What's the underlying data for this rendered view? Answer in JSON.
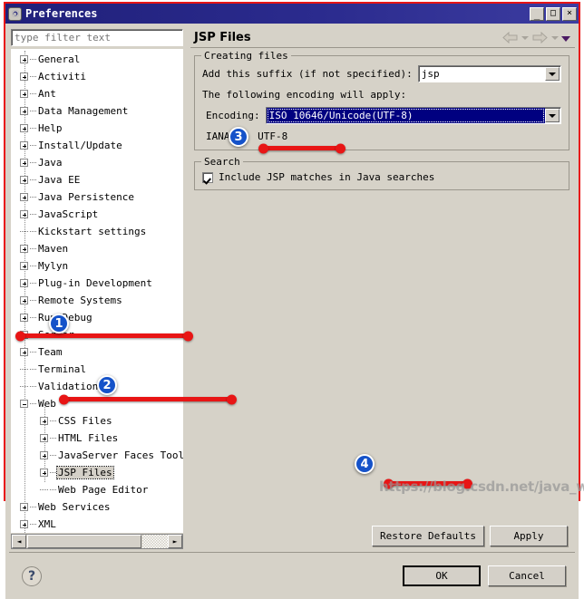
{
  "window": {
    "title": "Preferences",
    "icon": "gear-icon",
    "buttons": {
      "minimize": "_",
      "maximize": "□",
      "close": "×"
    }
  },
  "sidebar": {
    "filter": {
      "placeholder": "type filter text",
      "value": ""
    },
    "items": [
      {
        "label": "General",
        "depth": 0,
        "expander": "plus"
      },
      {
        "label": "Activiti",
        "depth": 0,
        "expander": "plus"
      },
      {
        "label": "Ant",
        "depth": 0,
        "expander": "plus"
      },
      {
        "label": "Data Management",
        "depth": 0,
        "expander": "plus"
      },
      {
        "label": "Help",
        "depth": 0,
        "expander": "plus"
      },
      {
        "label": "Install/Update",
        "depth": 0,
        "expander": "plus"
      },
      {
        "label": "Java",
        "depth": 0,
        "expander": "plus"
      },
      {
        "label": "Java EE",
        "depth": 0,
        "expander": "plus"
      },
      {
        "label": "Java Persistence",
        "depth": 0,
        "expander": "plus"
      },
      {
        "label": "JavaScript",
        "depth": 0,
        "expander": "plus"
      },
      {
        "label": "Kickstart settings",
        "depth": 0,
        "expander": "leaf"
      },
      {
        "label": "Maven",
        "depth": 0,
        "expander": "plus"
      },
      {
        "label": "Mylyn",
        "depth": 0,
        "expander": "plus"
      },
      {
        "label": "Plug-in Development",
        "depth": 0,
        "expander": "plus"
      },
      {
        "label": "Remote Systems",
        "depth": 0,
        "expander": "plus"
      },
      {
        "label": "Run/Debug",
        "depth": 0,
        "expander": "plus"
      },
      {
        "label": "Server",
        "depth": 0,
        "expander": "plus"
      },
      {
        "label": "Team",
        "depth": 0,
        "expander": "plus"
      },
      {
        "label": "Terminal",
        "depth": 0,
        "expander": "leaf"
      },
      {
        "label": "Validation",
        "depth": 0,
        "expander": "leaf"
      },
      {
        "label": "Web",
        "depth": 0,
        "expander": "minus"
      },
      {
        "label": "CSS Files",
        "depth": 1,
        "expander": "plus"
      },
      {
        "label": "HTML Files",
        "depth": 1,
        "expander": "plus"
      },
      {
        "label": "JavaServer Faces Tool",
        "depth": 1,
        "expander": "plus"
      },
      {
        "label": "JSP Files",
        "depth": 1,
        "expander": "plus",
        "selected": true
      },
      {
        "label": "Web Page Editor",
        "depth": 1,
        "expander": "leaf"
      },
      {
        "label": "Web Services",
        "depth": 0,
        "expander": "plus"
      },
      {
        "label": "XML",
        "depth": 0,
        "expander": "plus"
      }
    ],
    "hscroll": {
      "left_arrow": "◄",
      "right_arrow": "►"
    }
  },
  "page": {
    "title": "JSP Files",
    "nav": {
      "back": "back-arrow",
      "back_menu": "chevron-down-icon",
      "forward": "forward-arrow",
      "forward_menu": "chevron-down-icon",
      "view_menu": "view-menu-icon"
    },
    "creating_files": {
      "title": "Creating files",
      "suffix_label": "Add this suffix (if not specified):",
      "suffix_value": "jsp",
      "encoding_note": "The following encoding will apply:",
      "encoding_label": "Encoding:",
      "encoding_value": "ISO 10646/Unicode(UTF-8)",
      "iana_label": "IANA:",
      "iana_value": "UTF-8"
    },
    "search": {
      "title": "Search",
      "include_jsp_label": "Include JSP matches in Java searches",
      "include_jsp_checked": true
    },
    "restore_defaults_label": "Restore Defaults",
    "apply_label": "Apply"
  },
  "footer": {
    "help_icon": "?",
    "ok_label": "OK",
    "cancel_label": "Cancel"
  },
  "annotations": {
    "badges": [
      {
        "number": "1",
        "target": "tree-item-web"
      },
      {
        "number": "2",
        "target": "tree-item-jsp-files"
      },
      {
        "number": "3",
        "target": "encoding-combo"
      },
      {
        "number": "4",
        "target": "ok-button"
      }
    ],
    "watermark": "https://blog.csdn.net/java_wxid",
    "accent_color": "#e81515",
    "badge_color": "#1552c9"
  }
}
